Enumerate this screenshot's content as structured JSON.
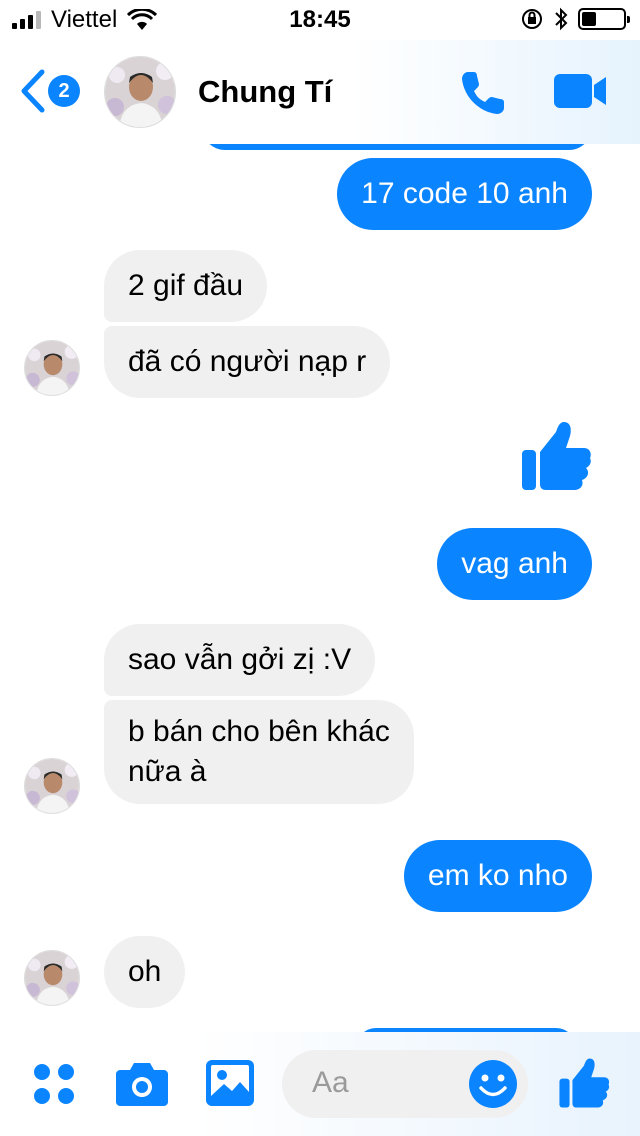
{
  "status_bar": {
    "carrier": "Viettel",
    "time": "18:45",
    "battery_level": 0.35,
    "icons": [
      "signal-icon",
      "wifi-icon",
      "rotation-lock-icon",
      "bluetooth-icon",
      "battery-icon"
    ]
  },
  "header": {
    "unread_count": "2",
    "contact_name": "Chung Tí",
    "icons": [
      "back-chevron-icon",
      "phone-icon",
      "video-camera-icon"
    ]
  },
  "messages": [
    {
      "sender": "me",
      "text": "17 code 10 anh"
    },
    {
      "sender": "contact",
      "text": "2 gif đầu"
    },
    {
      "sender": "contact",
      "text": "đã có người nạp r"
    },
    {
      "sender": "me",
      "type": "like",
      "icon": "thumbs-up-icon"
    },
    {
      "sender": "me",
      "text": "vag anh"
    },
    {
      "sender": "contact",
      "text": "sao vẫn gởi zị :V"
    },
    {
      "sender": "contact",
      "lines": [
        "b bán cho bên khác",
        "nữa à"
      ]
    },
    {
      "sender": "me",
      "text": "em ko nho"
    },
    {
      "sender": "contact",
      "text": "oh"
    }
  ],
  "composer": {
    "placeholder": "Aa",
    "icons": [
      "apps-grid-icon",
      "camera-icon",
      "gallery-icon",
      "emoji-icon",
      "thumbs-up-icon"
    ]
  },
  "colors": {
    "accent": "#0a84ff",
    "incoming_bubble": "#f1f0f0",
    "outgoing_text": "#ffffff"
  }
}
